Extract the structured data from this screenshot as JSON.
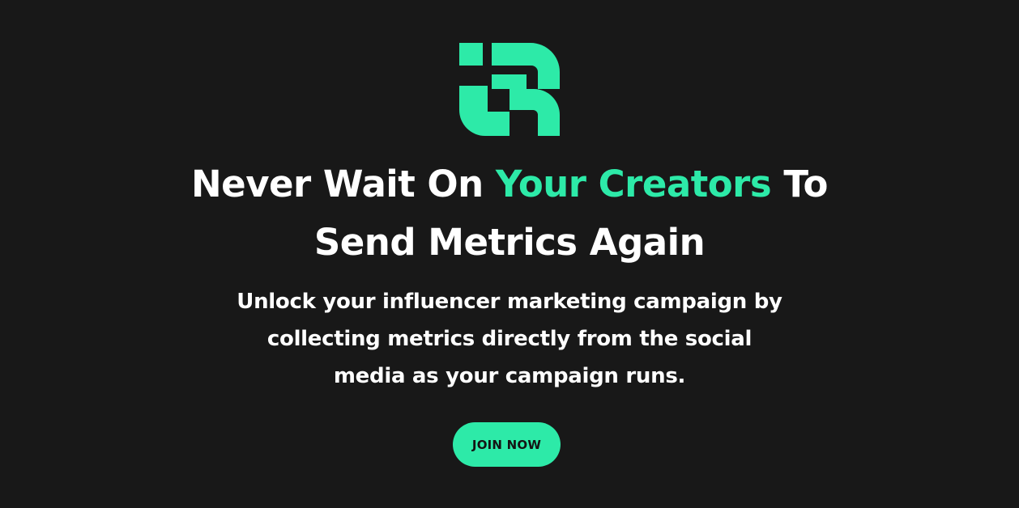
{
  "brand": {
    "logo_icon": "brand-logo-icon",
    "accent_color": "#2deaa8",
    "background_color": "#181818"
  },
  "hero": {
    "headline_part1": "Never Wait On ",
    "headline_accent": "Your Creators",
    "headline_part2": " To",
    "headline_line2": "Send Metrics Again",
    "subtext_line1": "Unlock your influencer marketing campaign by",
    "subtext_line2": "collecting metrics directly from the social",
    "subtext_line3": "media as your campaign runs."
  },
  "cta": {
    "label": "JOIN NOW"
  }
}
